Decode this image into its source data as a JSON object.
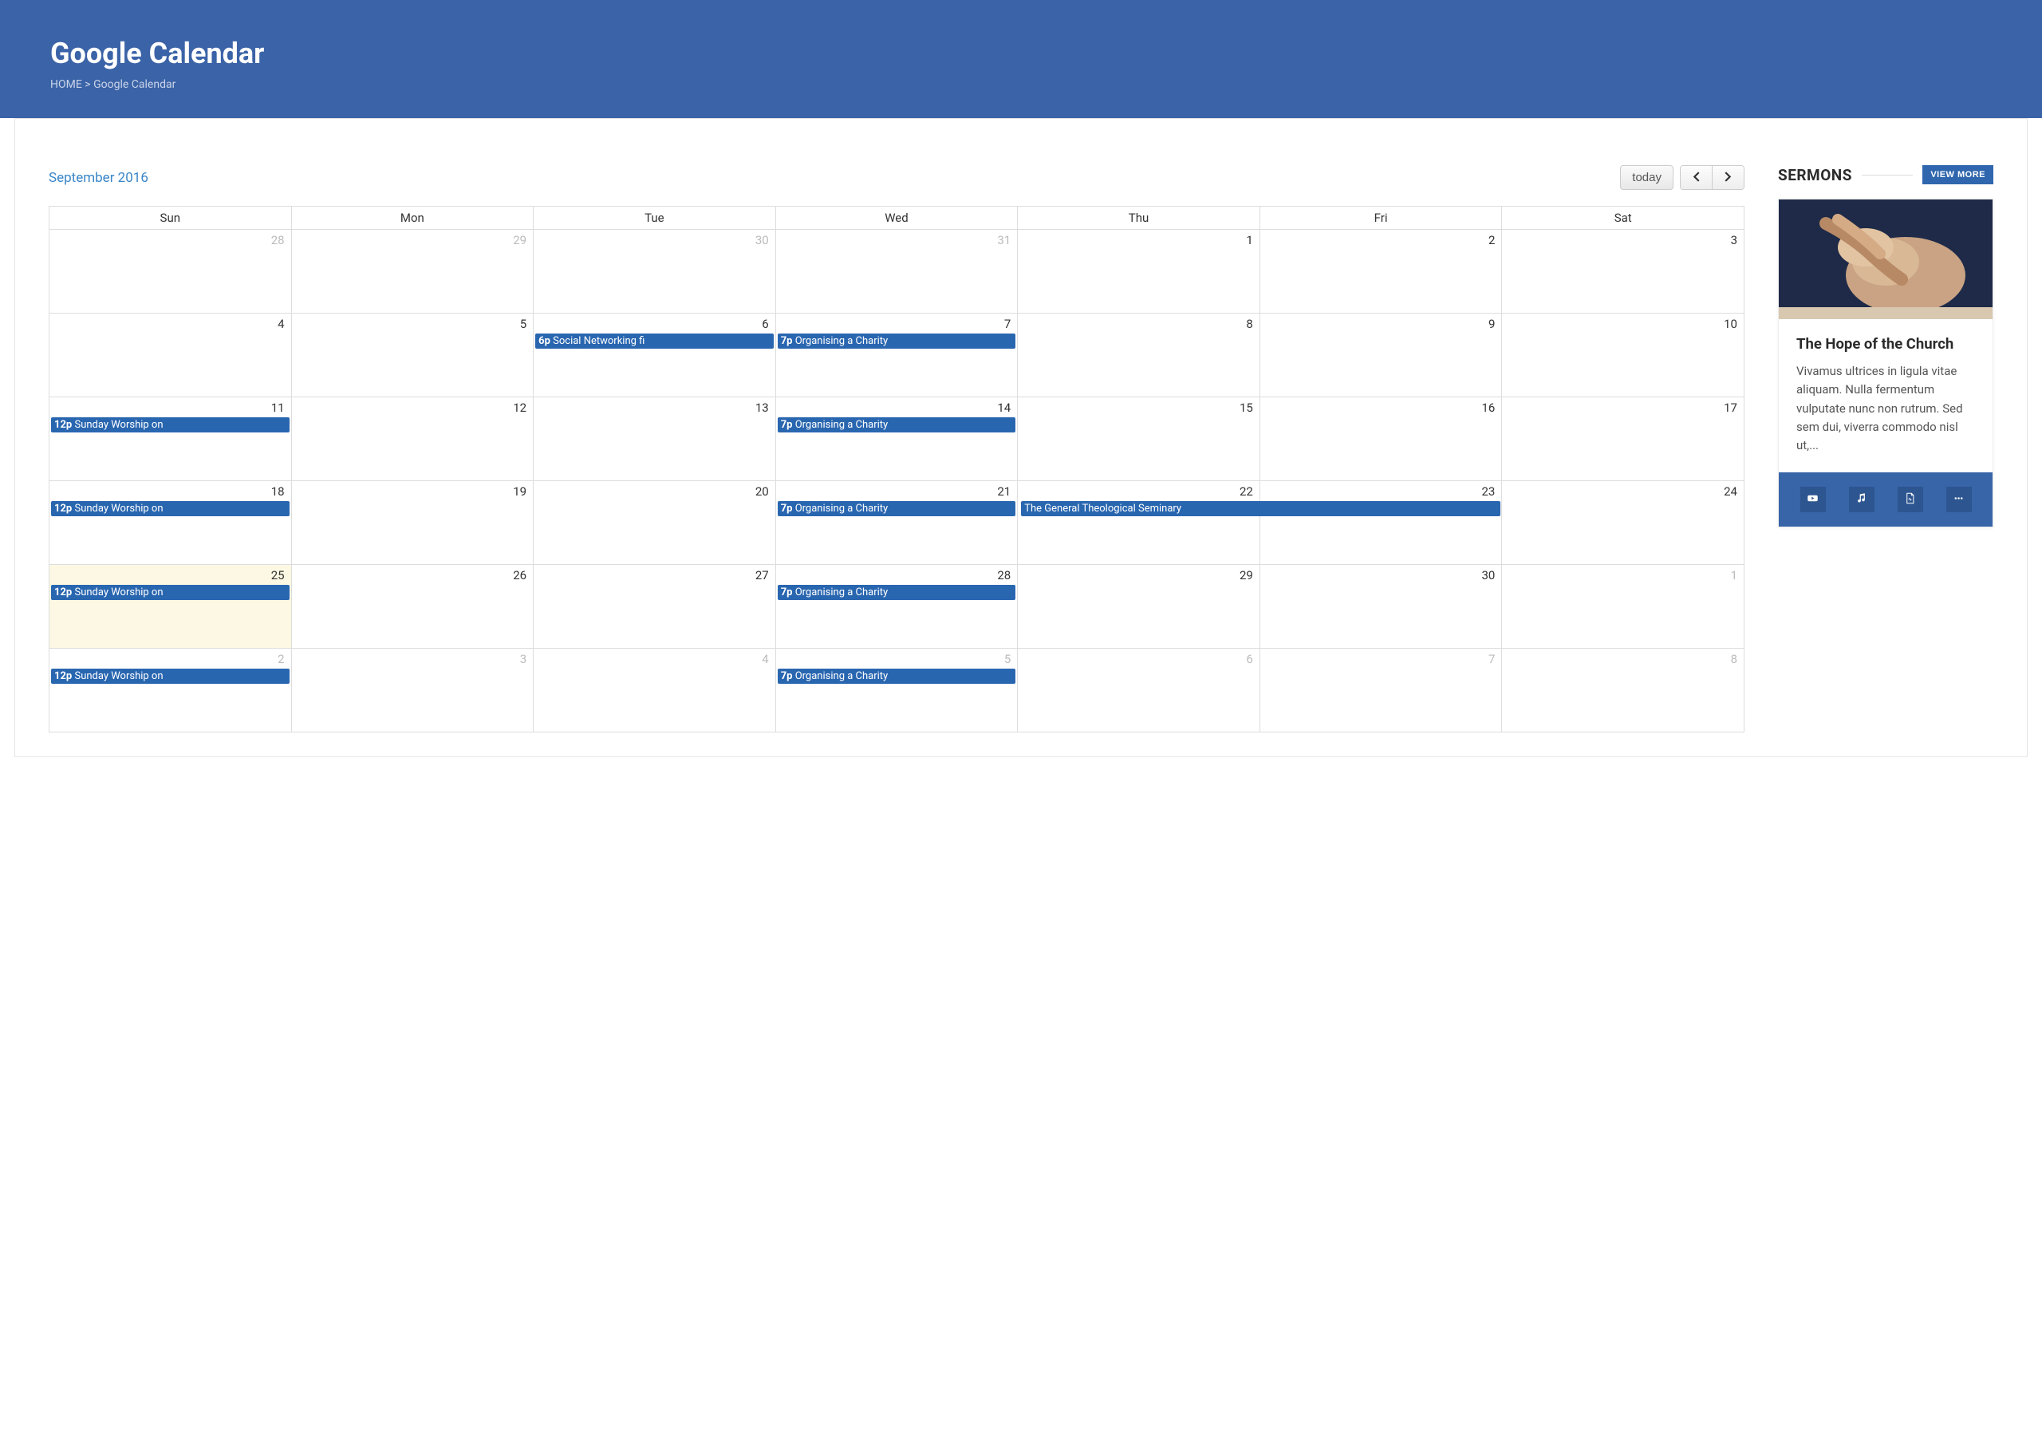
{
  "header": {
    "title": "Google Calendar",
    "breadcrumb_home": "HOME",
    "breadcrumb_sep": ">",
    "breadcrumb_current": "Google Calendar"
  },
  "calendar": {
    "month_label": "September 2016",
    "today_label": "today",
    "day_headers": [
      "Sun",
      "Mon",
      "Tue",
      "Wed",
      "Thu",
      "Fri",
      "Sat"
    ],
    "weeks": [
      [
        {
          "n": "28",
          "other": true,
          "events": []
        },
        {
          "n": "29",
          "other": true,
          "events": []
        },
        {
          "n": "30",
          "other": true,
          "events": []
        },
        {
          "n": "31",
          "other": true,
          "events": []
        },
        {
          "n": "1",
          "events": []
        },
        {
          "n": "2",
          "events": []
        },
        {
          "n": "3",
          "events": []
        }
      ],
      [
        {
          "n": "4",
          "events": []
        },
        {
          "n": "5",
          "events": []
        },
        {
          "n": "6",
          "events": [
            {
              "time": "6p",
              "title": "Social Networking fi"
            }
          ]
        },
        {
          "n": "7",
          "events": [
            {
              "time": "7p",
              "title": "Organising a Charity"
            }
          ]
        },
        {
          "n": "8",
          "events": []
        },
        {
          "n": "9",
          "events": []
        },
        {
          "n": "10",
          "events": []
        }
      ],
      [
        {
          "n": "11",
          "events": [
            {
              "time": "12p",
              "title": "Sunday Worship on"
            }
          ]
        },
        {
          "n": "12",
          "events": []
        },
        {
          "n": "13",
          "events": []
        },
        {
          "n": "14",
          "events": [
            {
              "time": "7p",
              "title": "Organising a Charity"
            }
          ]
        },
        {
          "n": "15",
          "events": []
        },
        {
          "n": "16",
          "events": []
        },
        {
          "n": "17",
          "events": []
        }
      ],
      [
        {
          "n": "18",
          "events": [
            {
              "time": "12p",
              "title": "Sunday Worship on"
            }
          ]
        },
        {
          "n": "19",
          "events": []
        },
        {
          "n": "20",
          "events": []
        },
        {
          "n": "21",
          "events": [
            {
              "time": "7p",
              "title": "Organising a Charity"
            }
          ]
        },
        {
          "n": "22",
          "events": [
            {
              "time": "",
              "title": "The General Theological Seminary",
              "span": 2
            }
          ]
        },
        {
          "n": "23",
          "events": []
        },
        {
          "n": "24",
          "events": []
        }
      ],
      [
        {
          "n": "25",
          "today": true,
          "events": [
            {
              "time": "12p",
              "title": "Sunday Worship on"
            }
          ]
        },
        {
          "n": "26",
          "events": []
        },
        {
          "n": "27",
          "events": []
        },
        {
          "n": "28",
          "events": [
            {
              "time": "7p",
              "title": "Organising a Charity"
            }
          ]
        },
        {
          "n": "29",
          "events": []
        },
        {
          "n": "30",
          "events": []
        },
        {
          "n": "1",
          "other": true,
          "events": []
        }
      ],
      [
        {
          "n": "2",
          "other": true,
          "events": [
            {
              "time": "12p",
              "title": "Sunday Worship on"
            }
          ]
        },
        {
          "n": "3",
          "other": true,
          "events": []
        },
        {
          "n": "4",
          "other": true,
          "events": []
        },
        {
          "n": "5",
          "other": true,
          "events": [
            {
              "time": "7p",
              "title": "Organising a Charity"
            }
          ]
        },
        {
          "n": "6",
          "other": true,
          "events": []
        },
        {
          "n": "7",
          "other": true,
          "events": []
        },
        {
          "n": "8",
          "other": true,
          "events": []
        }
      ]
    ]
  },
  "sidebar": {
    "title": "SERMONS",
    "view_more": "VIEW MORE",
    "sermon": {
      "title": "The Hope of the Church",
      "excerpt": "Vivamus ultrices in ligula vitae aliquam. Nulla fermentum vulputate nunc non rutrum. Sed sem dui, viverra commodo nisl ut,..."
    }
  }
}
